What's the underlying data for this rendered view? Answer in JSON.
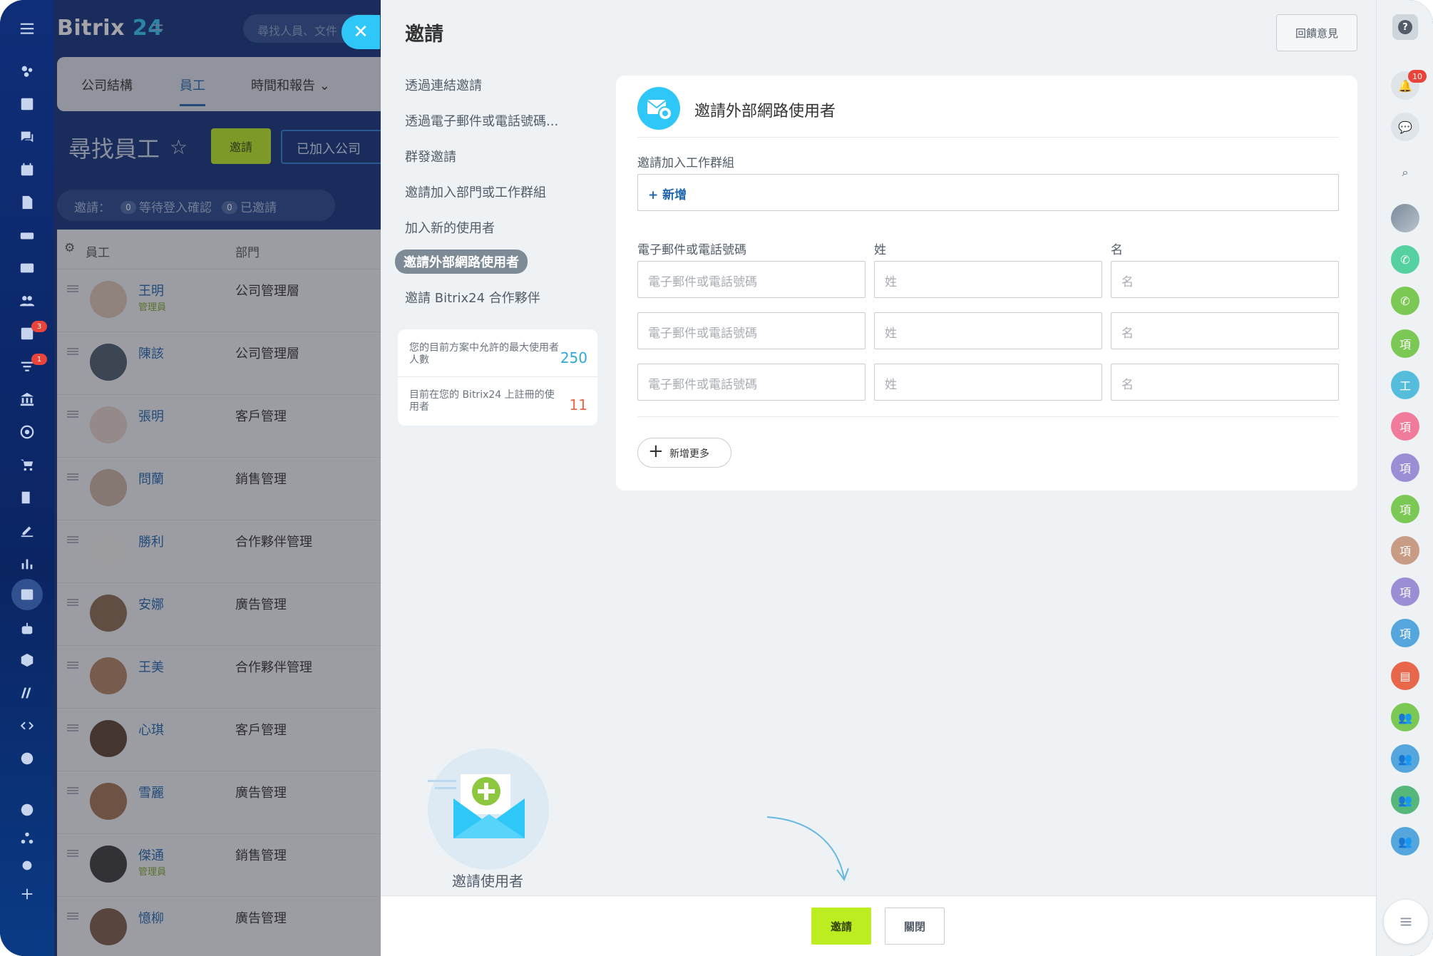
{
  "background_app": {
    "logo_text": "Bitrix",
    "logo_num": "24",
    "search_placeholder": "尋找人員、文件",
    "tabs": [
      {
        "label": "公司結構"
      },
      {
        "label": "員工"
      },
      {
        "label": "時間和報告"
      }
    ],
    "page_title": "尋找員工",
    "invite_button": "邀請",
    "joined_button": "已加入公司",
    "filter": {
      "prefix": "邀請：",
      "pending_count": "0",
      "pending_label": "等待登入確認",
      "invited_count": "0",
      "invited_label": "已邀請"
    },
    "table_headers": {
      "employee": "員工",
      "department": "部門"
    },
    "rows": [
      {
        "name": "王明",
        "role": "管理員",
        "dept": "公司管理層"
      },
      {
        "name": "陳該",
        "role": "",
        "dept": "公司管理層"
      },
      {
        "name": "張明",
        "role": "",
        "dept": "客戶管理"
      },
      {
        "name": "問蘭",
        "role": "",
        "dept": "銷售管理"
      },
      {
        "name": "勝利",
        "role": "",
        "dept": "合作夥伴管理"
      },
      {
        "name": "安娜",
        "role": "",
        "dept": "廣告管理"
      },
      {
        "name": "王美",
        "role": "",
        "dept": "合作夥伴管理"
      },
      {
        "name": "心琪",
        "role": "",
        "dept": "客戶管理"
      },
      {
        "name": "雪麗",
        "role": "",
        "dept": "廣告管理"
      },
      {
        "name": "傑通",
        "role": "管理員",
        "dept": "銷售管理"
      },
      {
        "name": "憶柳",
        "role": "",
        "dept": "廣告管理"
      }
    ]
  },
  "left_nav": {
    "badges": [
      "3",
      "1"
    ]
  },
  "panel": {
    "title": "邀請",
    "feedback_button": "回饋意見",
    "menu": [
      {
        "label": "透過連結邀請"
      },
      {
        "label": "透過電子郵件或電話號碼..."
      },
      {
        "label": "群發邀請"
      },
      {
        "label": "邀請加入部門或工作群組"
      },
      {
        "label": "加入新的使用者"
      },
      {
        "label": "邀請外部網路使用者"
      },
      {
        "label": "邀請 Bitrix24 合作夥伴"
      }
    ],
    "stats": [
      {
        "label": "您的目前方案中允許的最大使用者人數",
        "value": "250"
      },
      {
        "label": "目前在您的 Bitrix24 上註冊的使用者",
        "value": "11"
      }
    ],
    "card": {
      "title": "邀請外部網路使用者",
      "group_label": "邀請加入工作群組",
      "group_add": "+ 新增",
      "col_email": "電子郵件或電話號碼",
      "col_last": "姓",
      "col_first": "名",
      "email_placeholder": "電子郵件或電話號碼",
      "last_placeholder": "姓",
      "first_placeholder": "名",
      "add_more": "新增更多"
    },
    "illustration_caption": "邀請使用者",
    "footer": {
      "invite": "邀請",
      "close": "關閉"
    }
  },
  "right_rail": {
    "notif_count": "10",
    "chips": [
      "項",
      "工",
      "項",
      "項",
      "項",
      "項",
      "項",
      "項"
    ]
  },
  "colors": {
    "accent_green": "#bbed21",
    "brand_blue": "#2fc7f7",
    "nav_bg": "#0f2e78"
  }
}
